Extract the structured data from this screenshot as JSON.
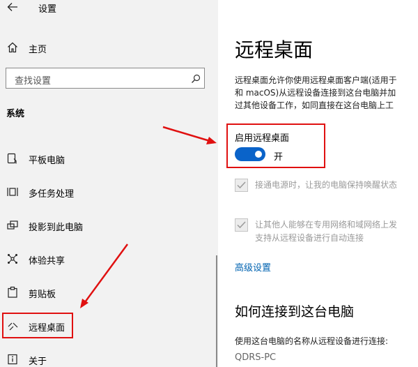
{
  "app": {
    "title": "设置"
  },
  "sidebar": {
    "home": "主页",
    "search_placeholder": "查找设置",
    "section": "系统",
    "items": [
      {
        "label": "平板电脑",
        "icon": "tablet-icon"
      },
      {
        "label": "多任务处理",
        "icon": "multitasking-icon"
      },
      {
        "label": "投影到此电脑",
        "icon": "project-icon"
      },
      {
        "label": "体验共享",
        "icon": "share-icon"
      },
      {
        "label": "剪贴板",
        "icon": "clipboard-icon"
      },
      {
        "label": "远程桌面",
        "icon": "remote-desktop-icon",
        "selected": true
      },
      {
        "label": "关于",
        "icon": "info-icon"
      }
    ]
  },
  "main": {
    "title": "远程桌面",
    "description": [
      "远程桌面允许你使用远程桌面客户端(适用于",
      "和 macOS)从远程设备连接到这台电脑并加",
      "过其他设备工作，如同直接在这台电脑上工"
    ],
    "toggle": {
      "label": "启用远程桌面",
      "state": "开",
      "on": true
    },
    "checkbox1": {
      "lines": [
        "接通电源时，让我的电脑保持唤醒状态"
      ],
      "checked": true
    },
    "checkbox2": {
      "lines": [
        "让其他人能够在专用网络和域网络上发",
        "支持从远程设备进行自动连接"
      ],
      "checked": true
    },
    "advanced_link": "高级设置",
    "how_to_title": "如何连接到这台电脑",
    "how_to_desc": "使用这台电脑的名称从远程设备进行连接:",
    "pc_name": "QDRS-PC"
  },
  "colors": {
    "accent": "#0a63c9",
    "link": "#0063b1",
    "annotation": "#e01010"
  }
}
